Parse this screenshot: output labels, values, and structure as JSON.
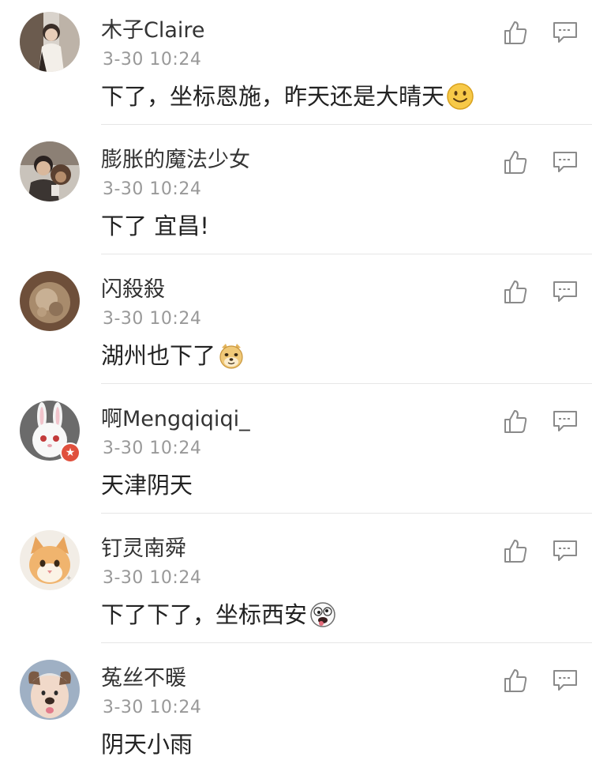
{
  "colors": {
    "username": "#333333",
    "timestamp": "#999999",
    "content": "#222222",
    "divider": "#e6e6e6",
    "icon": "#8a8a8a"
  },
  "comments": [
    {
      "username": "木子Claire",
      "time": "3-30 10:24",
      "text": "下了，坐标恩施，昨天还是大晴天",
      "emoji": "smiley-emoji",
      "avatar": "avatar-person-light"
    },
    {
      "username": "膨胀的魔法少女",
      "time": "3-30 10:24",
      "text": "下了 宜昌!",
      "emoji": null,
      "avatar": "avatar-person-with-monkey"
    },
    {
      "username": "闪殺殺",
      "time": "3-30 10:24",
      "text": "湖州也下了",
      "emoji": "doge-emoji",
      "avatar": "avatar-brown-texture"
    },
    {
      "username": "啊Mengqiqiqi_",
      "time": "3-30 10:24",
      "text": "天津阴天",
      "emoji": null,
      "avatar": "avatar-white-rabbit",
      "vip_badge": "★"
    },
    {
      "username": "钉灵南舜",
      "time": "3-30 10:24",
      "text": "下了下了，坐标西安",
      "emoji": "crazy-face-emoji",
      "avatar": "avatar-orange-cat"
    },
    {
      "username": "菟丝不暖",
      "time": "3-30 10:24",
      "text": "阴天小雨",
      "emoji": null,
      "avatar": "avatar-dog-filter-face"
    }
  ]
}
